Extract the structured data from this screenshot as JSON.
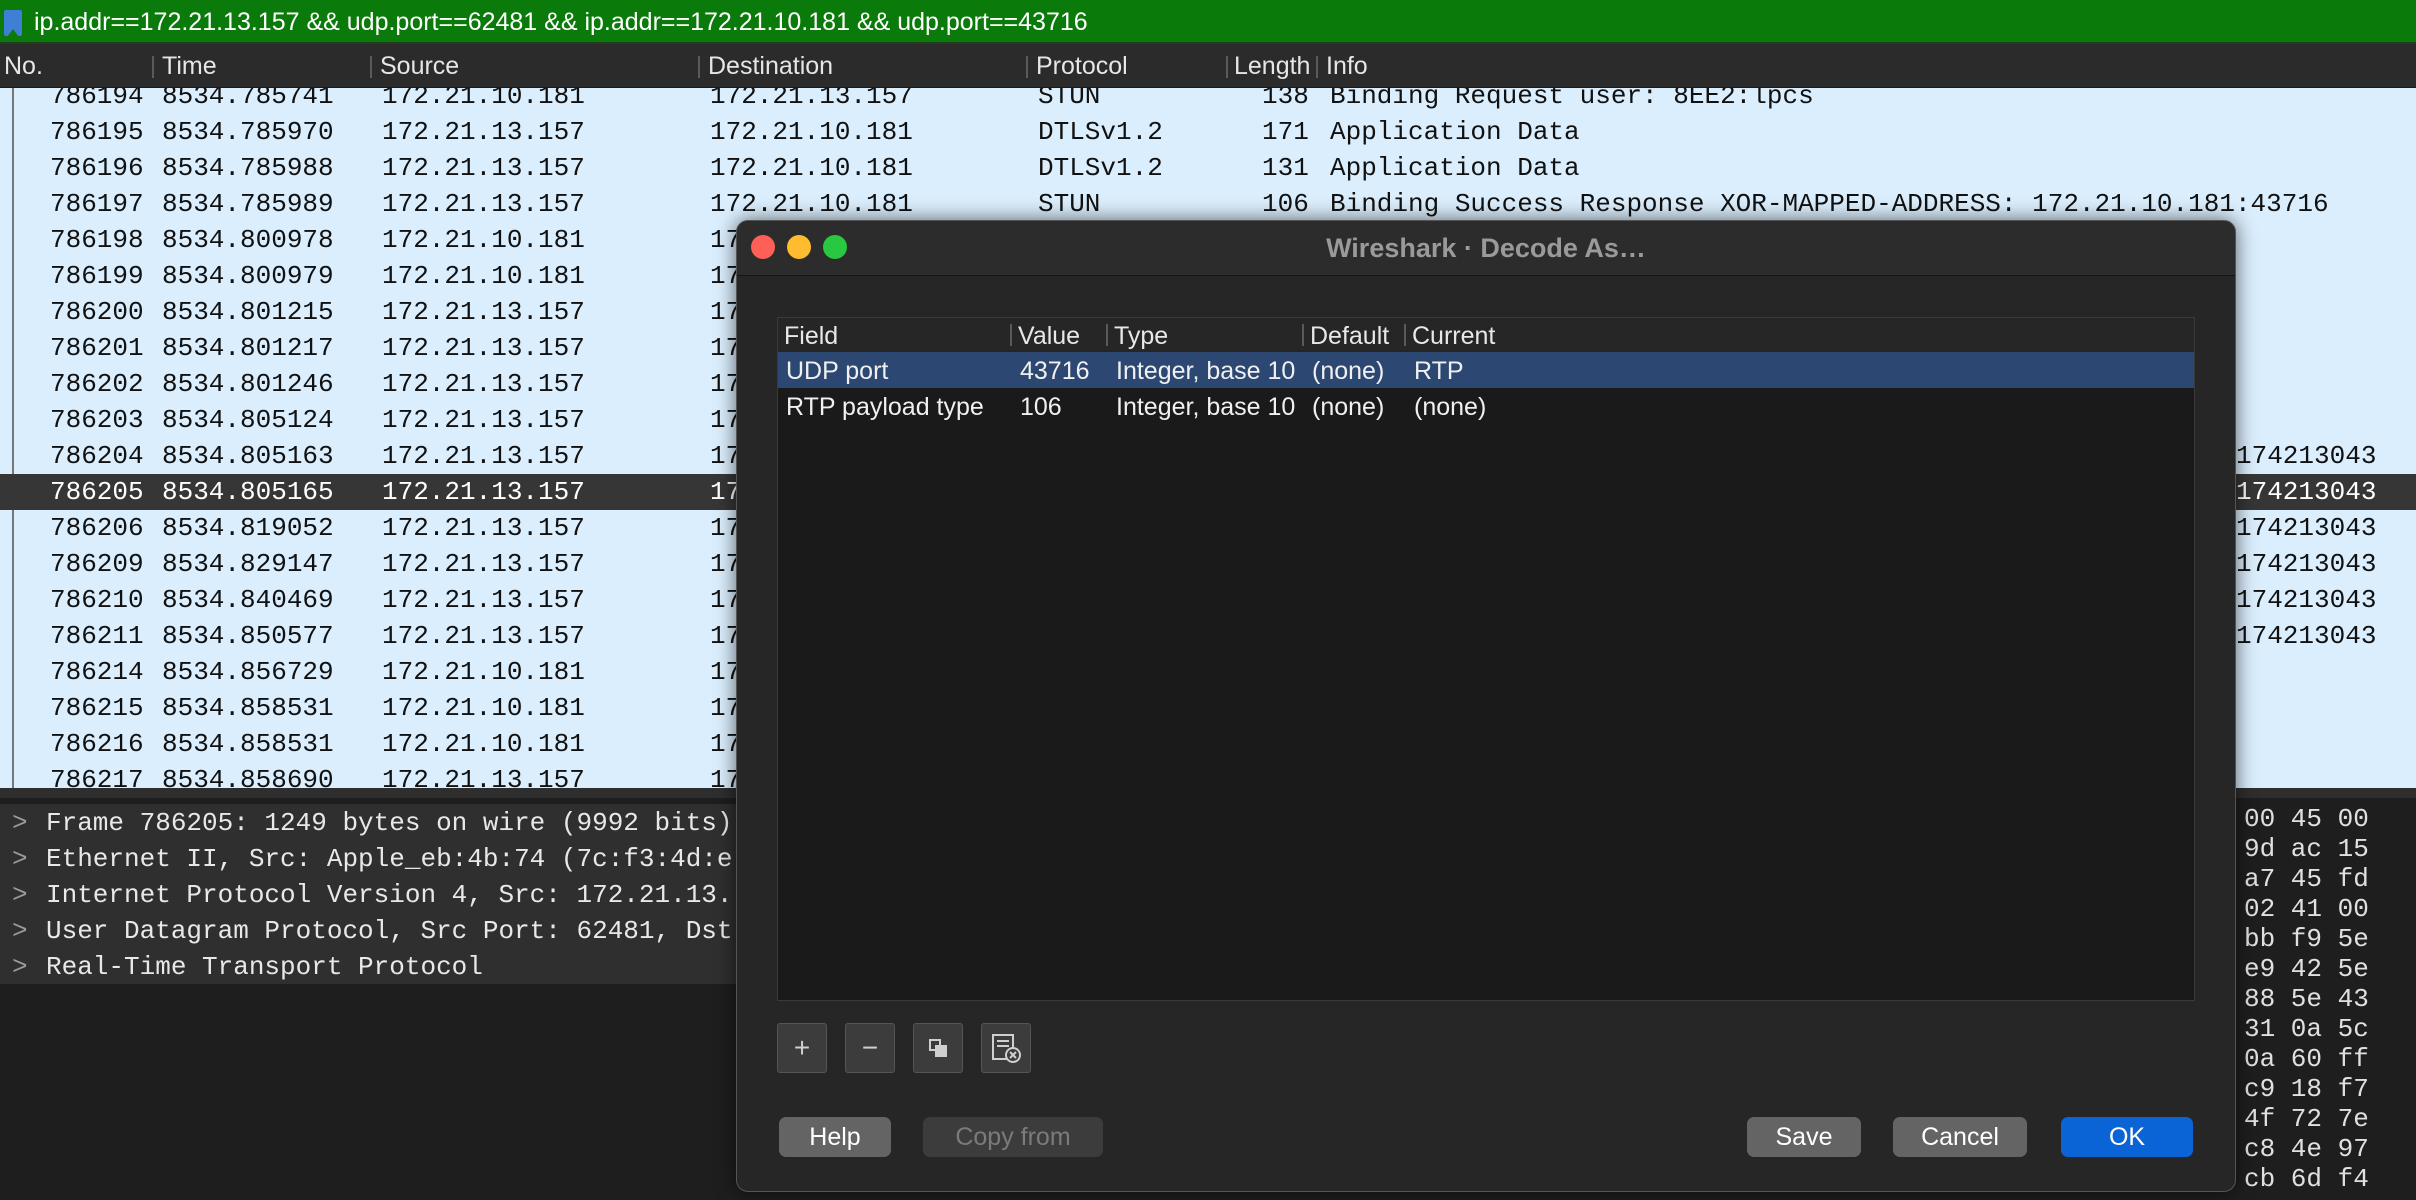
{
  "filter": {
    "value": "ip.addr==172.21.13.157 && udp.port==62481 && ip.addr==172.21.10.181 && udp.port==43716"
  },
  "packet_list": {
    "columns": [
      "No.",
      "Time",
      "Source",
      "Destination",
      "Protocol",
      "Length",
      "Info"
    ],
    "rows": [
      {
        "no": "786194",
        "time": "8534.785741",
        "src": "172.21.10.181",
        "dst": "172.21.13.157",
        "proto": "STUN",
        "len": "138",
        "info": "Binding Request user: 8EE2:lpcs",
        "tail": ""
      },
      {
        "no": "786195",
        "time": "8534.785970",
        "src": "172.21.13.157",
        "dst": "172.21.10.181",
        "proto": "DTLSv1.2",
        "len": "171",
        "info": "Application Data",
        "tail": ""
      },
      {
        "no": "786196",
        "time": "8534.785988",
        "src": "172.21.13.157",
        "dst": "172.21.10.181",
        "proto": "DTLSv1.2",
        "len": "131",
        "info": "Application Data",
        "tail": ""
      },
      {
        "no": "786197",
        "time": "8534.785989",
        "src": "172.21.13.157",
        "dst": "172.21.10.181",
        "proto": "STUN",
        "len": "106",
        "info": "Binding Success Response XOR-MAPPED-ADDRESS: 172.21.10.181:43716",
        "tail": ""
      },
      {
        "no": "786198",
        "time": "8534.800978",
        "src": "172.21.10.181",
        "dst": "17",
        "proto": "",
        "len": "",
        "info": "",
        "tail": ""
      },
      {
        "no": "786199",
        "time": "8534.800979",
        "src": "172.21.10.181",
        "dst": "17",
        "proto": "",
        "len": "",
        "info": "",
        "tail": ""
      },
      {
        "no": "786200",
        "time": "8534.801215",
        "src": "172.21.13.157",
        "dst": "17",
        "proto": "",
        "len": "",
        "info": "",
        "tail": ""
      },
      {
        "no": "786201",
        "time": "8534.801217",
        "src": "172.21.13.157",
        "dst": "17",
        "proto": "",
        "len": "",
        "info": "",
        "tail": ""
      },
      {
        "no": "786202",
        "time": "8534.801246",
        "src": "172.21.13.157",
        "dst": "17",
        "proto": "",
        "len": "",
        "info": "",
        "tail": ""
      },
      {
        "no": "786203",
        "time": "8534.805124",
        "src": "172.21.13.157",
        "dst": "17",
        "proto": "",
        "len": "",
        "info": "",
        "tail": ""
      },
      {
        "no": "786204",
        "time": "8534.805163",
        "src": "172.21.13.157",
        "dst": "17",
        "proto": "",
        "len": "",
        "info": "",
        "tail": "174213043"
      },
      {
        "no": "786205",
        "time": "8534.805165",
        "src": "172.21.13.157",
        "dst": "17",
        "proto": "",
        "len": "",
        "info": "",
        "tail": "174213043"
      },
      {
        "no": "786206",
        "time": "8534.819052",
        "src": "172.21.13.157",
        "dst": "17",
        "proto": "",
        "len": "",
        "info": "",
        "tail": "174213043"
      },
      {
        "no": "786209",
        "time": "8534.829147",
        "src": "172.21.13.157",
        "dst": "17",
        "proto": "",
        "len": "",
        "info": "",
        "tail": "174213043"
      },
      {
        "no": "786210",
        "time": "8534.840469",
        "src": "172.21.13.157",
        "dst": "17",
        "proto": "",
        "len": "",
        "info": "",
        "tail": "174213043"
      },
      {
        "no": "786211",
        "time": "8534.850577",
        "src": "172.21.13.157",
        "dst": "17",
        "proto": "",
        "len": "",
        "info": "",
        "tail": "174213043"
      },
      {
        "no": "786214",
        "time": "8534.856729",
        "src": "172.21.10.181",
        "dst": "17",
        "proto": "",
        "len": "",
        "info": "",
        "tail": ""
      },
      {
        "no": "786215",
        "time": "8534.858531",
        "src": "172.21.10.181",
        "dst": "17",
        "proto": "",
        "len": "",
        "info": "",
        "tail": ""
      },
      {
        "no": "786216",
        "time": "8534.858531",
        "src": "172.21.10.181",
        "dst": "17",
        "proto": "",
        "len": "",
        "info": "",
        "tail": ""
      },
      {
        "no": "786217",
        "time": "8534.858690",
        "src": "172.21.13.157",
        "dst": "17",
        "proto": "",
        "len": "",
        "info": "",
        "tail": ""
      }
    ],
    "selected_no": "786205"
  },
  "details": [
    "Frame 786205: 1249 bytes on wire (9992 bits)",
    "Ethernet II, Src: Apple_eb:4b:74 (7c:f3:4d:e",
    "Internet Protocol Version 4, Src: 172.21.13.",
    "User Datagram Protocol, Src Port: 62481, Dst",
    "Real-Time Transport Protocol"
  ],
  "details_chevron": ">",
  "hex": [
    "00 45 00",
    "9d ac 15",
    "a7 45 fd",
    "02 41 00",
    "bb f9 5e",
    "e9 42 5e",
    "88 5e 43",
    "31 0a 5c",
    "0a 60 ff",
    "c9 18 f7",
    "4f 72 7e",
    "c8 4e 97",
    "cb 6d f4"
  ],
  "dialog": {
    "title": "Wireshark · Decode As…",
    "columns": [
      "Field",
      "Value",
      "Type",
      "Default",
      "Current"
    ],
    "rows": [
      {
        "field": "UDP port",
        "value": "43716",
        "type": "Integer, base 10",
        "default": "(none)",
        "current": "RTP"
      },
      {
        "field": "RTP payload type",
        "value": "106",
        "type": "Integer, base 10",
        "default": "(none)",
        "current": "(none)"
      }
    ],
    "tool_buttons": {
      "add": "+",
      "remove": "−"
    },
    "buttons": {
      "help": "Help",
      "copy_from": "Copy from",
      "save": "Save",
      "cancel": "Cancel",
      "ok": "OK"
    }
  },
  "colors": {
    "filter_bar": "#0a7a0a",
    "row_bg": "#dbeefd",
    "selected_row": "#363636",
    "dialog_selected": "#2c4872",
    "accent_button": "#0a64d6"
  }
}
